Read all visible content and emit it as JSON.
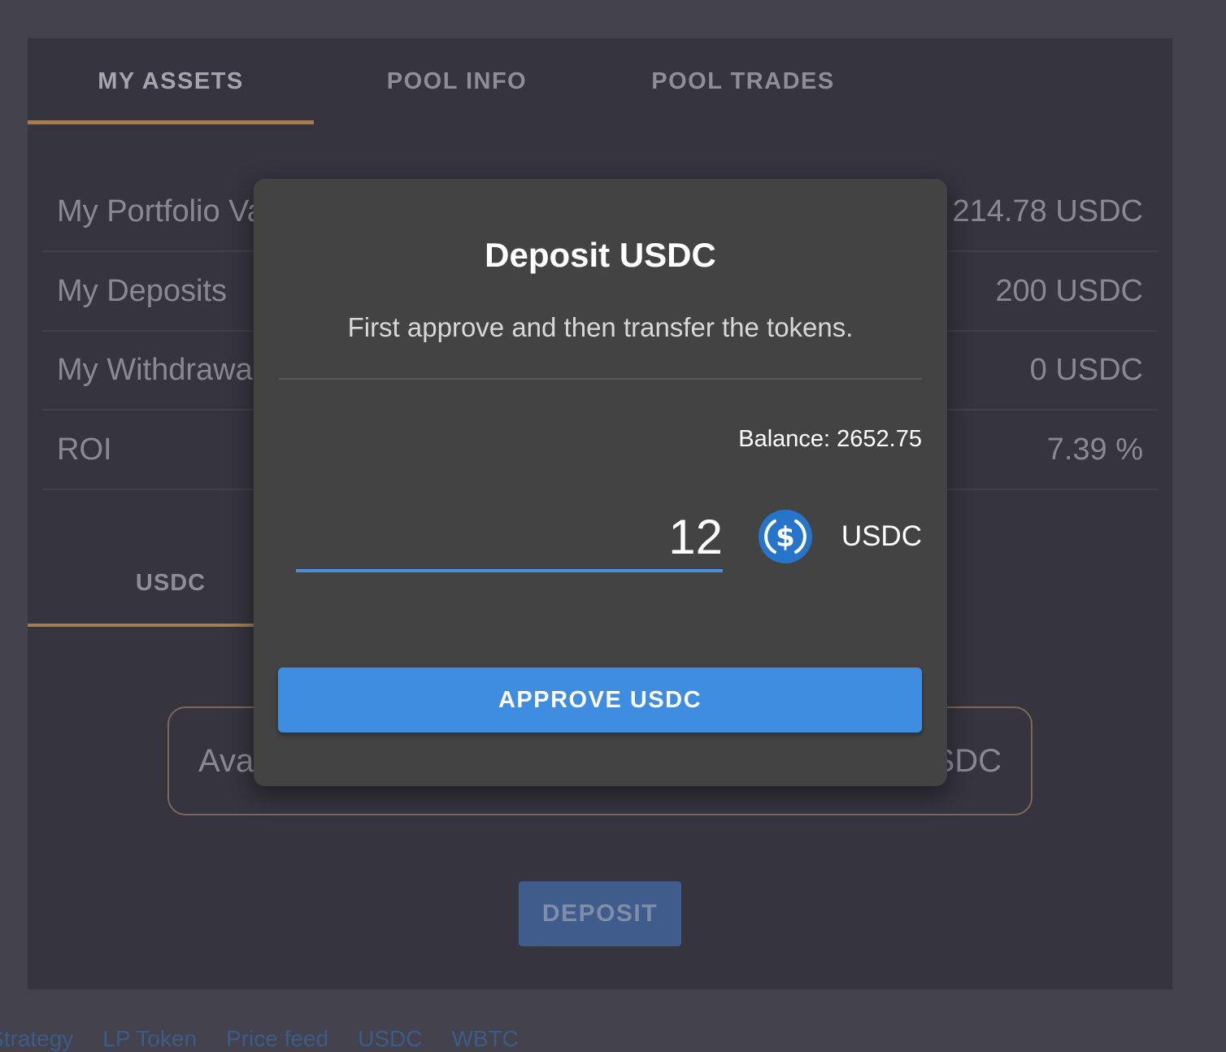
{
  "tabs": [
    {
      "label": "MY ASSETS",
      "active": true
    },
    {
      "label": "POOL INFO",
      "active": false
    },
    {
      "label": "POOL TRADES",
      "active": false
    }
  ],
  "stats": [
    {
      "label": "My Portfolio Value",
      "value": "214.78 USDC"
    },
    {
      "label": "My Deposits",
      "value": "200 USDC"
    },
    {
      "label": "My Withdrawals",
      "value": "0 USDC"
    },
    {
      "label": "ROI",
      "value": "7.39 %"
    }
  ],
  "subtabs": [
    {
      "label": "USDC",
      "active": true
    }
  ],
  "available": {
    "label": "Available",
    "value": "USDC"
  },
  "deposit_button": "DEPOSIT",
  "footer_links": [
    "Strategy",
    "LP Token",
    "Price feed",
    "USDC",
    "WBTC"
  ],
  "modal": {
    "title": "Deposit USDC",
    "subtitle": "First approve and then transfer the tokens.",
    "balance": "Balance: 2652.75",
    "amount": "12",
    "currency": "USDC",
    "approve_button": "APPROVE USDC"
  },
  "colors": {
    "accent": "#a27b57",
    "primary": "#3e8de0",
    "usdc_blue": "#2775ca"
  },
  "icons": {
    "token": "usdc-coin-icon"
  }
}
